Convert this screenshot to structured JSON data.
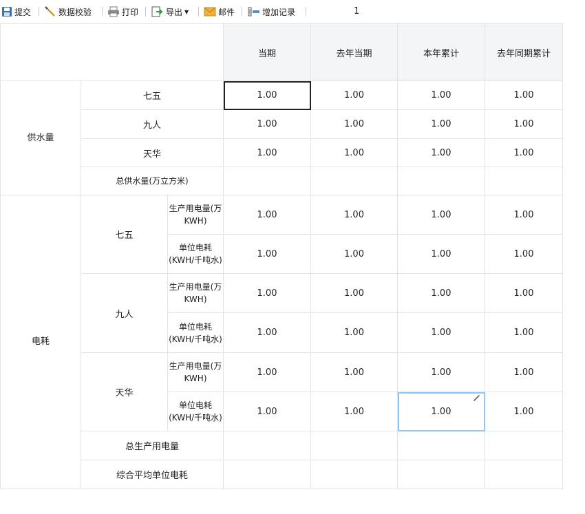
{
  "toolbar": {
    "submit": "提交",
    "validate": "数据校验",
    "print": "打印",
    "export": "导出",
    "mail": "邮件",
    "add_record": "增加记录",
    "page": "1"
  },
  "columns": [
    "当期",
    "去年当期",
    "本年累计",
    "去年同期累计"
  ],
  "water": {
    "label": "供水量",
    "rows": [
      {
        "name": "七五",
        "values": [
          "1.00",
          "1.00",
          "1.00",
          "1.00"
        ]
      },
      {
        "name": "九人",
        "values": [
          "1.00",
          "1.00",
          "1.00",
          "1.00"
        ]
      },
      {
        "name": "天华",
        "values": [
          "1.00",
          "1.00",
          "1.00",
          "1.00"
        ]
      }
    ],
    "total_label": "总供水量(万立方米)"
  },
  "power": {
    "label": "电耗",
    "metric1": "生产用电量(万KWH)",
    "metric2": "单位电耗(KWH/千吨水)",
    "groups": [
      {
        "name": "七五",
        "r1": [
          "1.00",
          "1.00",
          "1.00",
          "1.00"
        ],
        "r2": [
          "1.00",
          "1.00",
          "1.00",
          "1.00"
        ]
      },
      {
        "name": "九人",
        "r1": [
          "1.00",
          "1.00",
          "1.00",
          "1.00"
        ],
        "r2": [
          "1.00",
          "1.00",
          "1.00",
          "1.00"
        ]
      },
      {
        "name": "天华",
        "r1": [
          "1.00",
          "1.00",
          "1.00",
          "1.00"
        ],
        "r2": [
          "1.00",
          "1.00",
          "1.00",
          "1.00"
        ]
      }
    ],
    "total_label": "总生产用电量",
    "avg_label": "综合平均单位电耗"
  }
}
